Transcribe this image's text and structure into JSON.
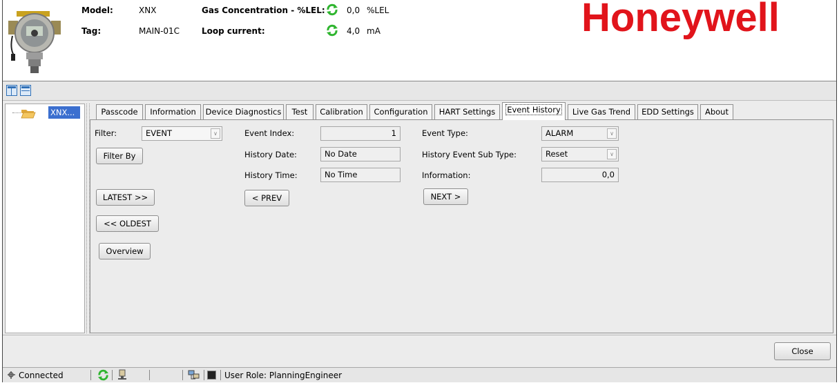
{
  "header": {
    "model_label": "Model:",
    "model_value": "XNX",
    "tag_label": "Tag:",
    "tag_value": "MAIN-01C",
    "gas_label": "Gas Concentration - %LEL:",
    "gas_value": "0,0",
    "gas_unit": "%LEL",
    "loop_label": "Loop current:",
    "loop_value": "4,0",
    "loop_unit": "mA",
    "logo": "Honeywell"
  },
  "tree": {
    "node_label": "XNX..."
  },
  "tabs": [
    {
      "label": "Passcode"
    },
    {
      "label": "Information"
    },
    {
      "label": "Device Diagnostics"
    },
    {
      "label": "Test"
    },
    {
      "label": "Calibration"
    },
    {
      "label": "Configuration"
    },
    {
      "label": "HART Settings"
    },
    {
      "label": "Event History",
      "active": true
    },
    {
      "label": "Live Gas Trend"
    },
    {
      "label": "EDD Settings"
    },
    {
      "label": "About"
    }
  ],
  "event_history": {
    "filter_label": "Filter:",
    "filter_value": "EVENT",
    "filter_by_button": "Filter By",
    "latest_button": "LATEST >>",
    "oldest_button": "<< OLDEST",
    "overview_button": "Overview",
    "event_index_label": "Event Index:",
    "event_index_value": "1",
    "history_date_label": "History Date:",
    "history_date_value": "No Date",
    "history_time_label": "History Time:",
    "history_time_value": "No Time",
    "prev_button": "< PREV",
    "event_type_label": "Event Type:",
    "event_type_value": "ALARM",
    "sub_type_label": "History Event Sub Type:",
    "sub_type_value": "Reset",
    "information_label": "Information:",
    "information_value": "0,0",
    "next_button": "NEXT >"
  },
  "footer": {
    "close_button": "Close"
  },
  "statusbar": {
    "connection": "Connected",
    "user_role": "User Role: PlanningEngineer"
  },
  "colors": {
    "brand": "#e1141b",
    "refresh_green": "#2fb52f"
  }
}
